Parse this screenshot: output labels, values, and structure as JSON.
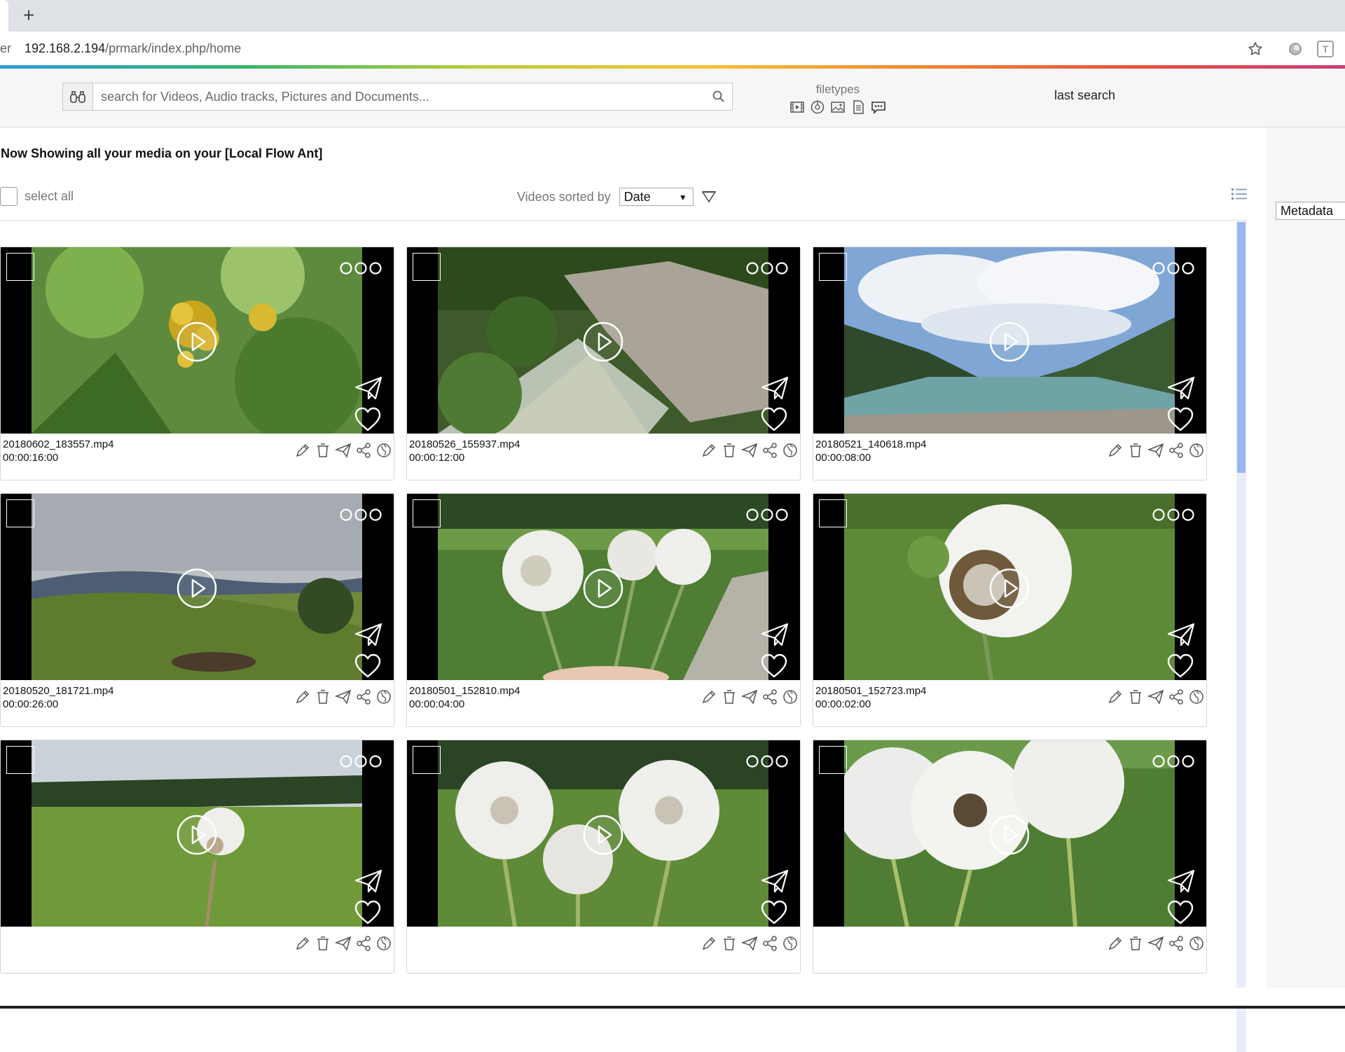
{
  "browser": {
    "tab_fragment_text": "er",
    "new_tab_label": "+",
    "url_host": "192.168.2.194",
    "url_path": "/prmark/index.php/home",
    "extension_label": "T"
  },
  "header": {
    "search_placeholder": "search for Videos, Audio tracks, Pictures and Documents...",
    "filetypes_label": "filetypes",
    "filetype_icons": [
      "video-icon",
      "audio-icon",
      "picture-icon",
      "document-icon",
      "comment-icon"
    ],
    "last_search_label": "last search"
  },
  "main": {
    "heading": "Now Showing all your media on your [Local Flow Ant]",
    "select_all_label": "select all",
    "sort_label": "Videos sorted by",
    "sort_value": "Date",
    "metadata_button": "Metadata",
    "action_icons": [
      "edit-icon",
      "delete-icon",
      "send-icon",
      "share-icon",
      "globe-icon"
    ],
    "cards": [
      {
        "name": "20180602_183557.mp4",
        "duration": "00:00:16:00",
        "scene": "flower"
      },
      {
        "name": "20180526_155937.mp4",
        "duration": "00:00:12:00",
        "scene": "gorge"
      },
      {
        "name": "20180521_140618.mp4",
        "duration": "00:00:08:00",
        "scene": "valley"
      },
      {
        "name": "20180520_181721.mp4",
        "duration": "00:00:26:00",
        "scene": "meadow-hills"
      },
      {
        "name": "20180501_152810.mp4",
        "duration": "00:00:04:00",
        "scene": "dandelions-hand"
      },
      {
        "name": "20180501_152723.mp4",
        "duration": "00:00:02:00",
        "scene": "dandelion-big"
      },
      {
        "name": "",
        "duration": "",
        "scene": "dandelion-meadow"
      },
      {
        "name": "",
        "duration": "",
        "scene": "dandelions-forest"
      },
      {
        "name": "",
        "duration": "",
        "scene": "dandelion-cluster"
      }
    ]
  }
}
